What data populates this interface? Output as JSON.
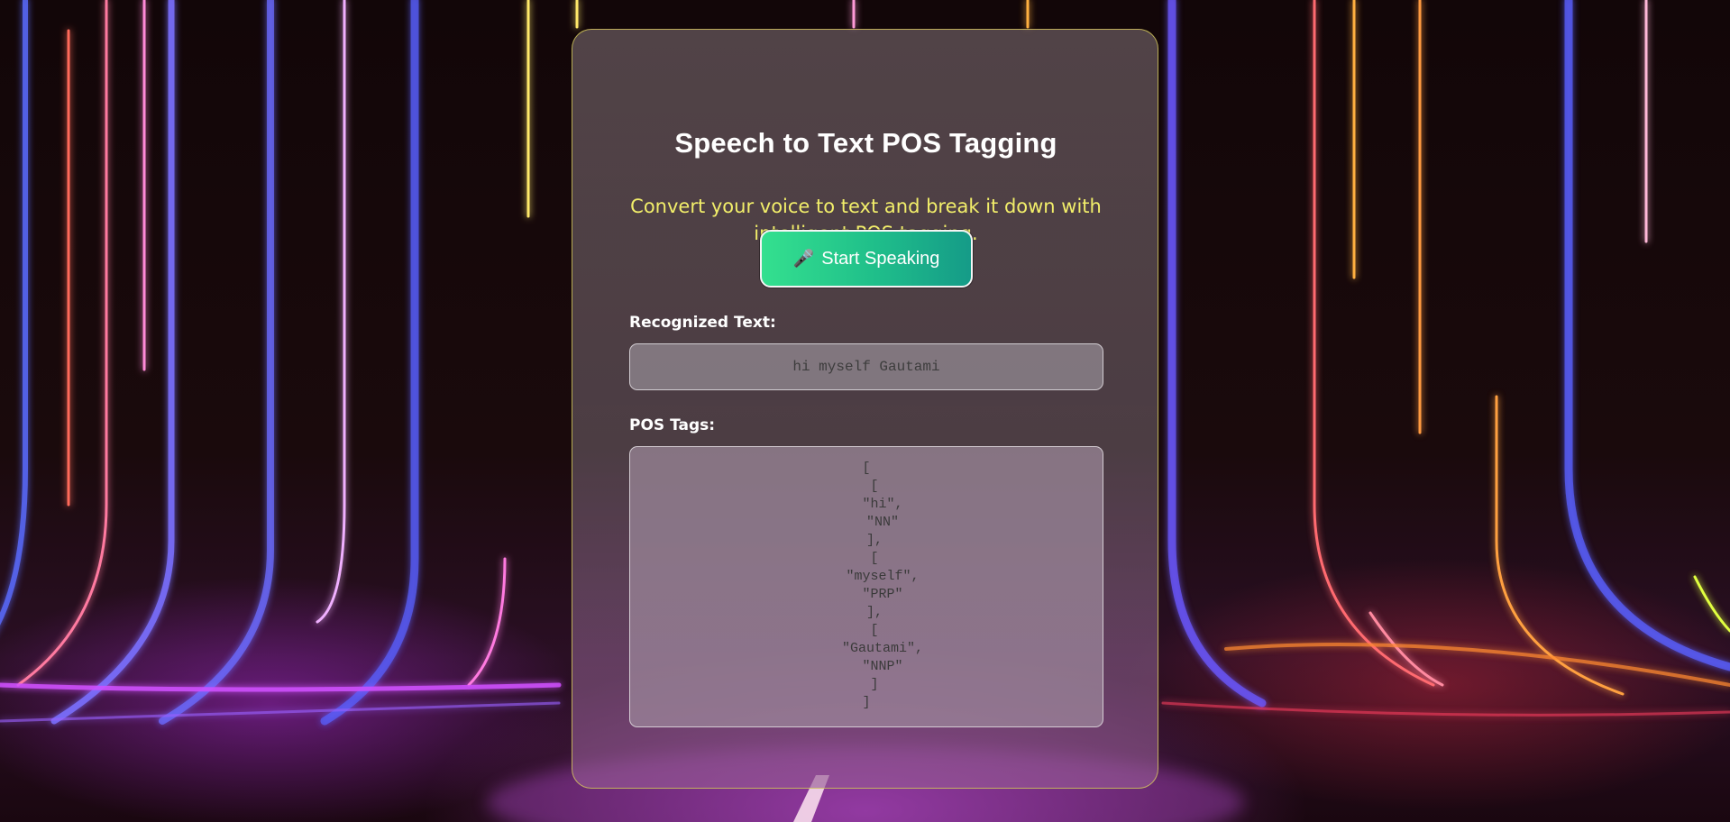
{
  "header": {
    "title": "Speech to Text POS Tagging",
    "subtitle": "Convert your voice to text and break it down with intelligent POS tagging."
  },
  "controls": {
    "speak_button_icon": "microphone-icon",
    "speak_button_icon_glyph": "🎤",
    "speak_button_label": "Start Speaking"
  },
  "recognized": {
    "label": "Recognized Text:",
    "value": "hi myself Gautami"
  },
  "pos": {
    "label": "POS Tags:",
    "output": "[\n  [\n    \"hi\",\n    \"NN\"\n  ],\n  [\n    \"myself\",\n    \"PRP\"\n  ],\n  [\n    \"Gautami\",\n    \"NNP\"\n  ]\n]"
  },
  "colors": {
    "title": "#ffffff",
    "subtitle": "#f2ee6a",
    "button_gradient_start": "#34e08f",
    "button_gradient_end": "#159b88",
    "card_border": "#dcd25a"
  }
}
